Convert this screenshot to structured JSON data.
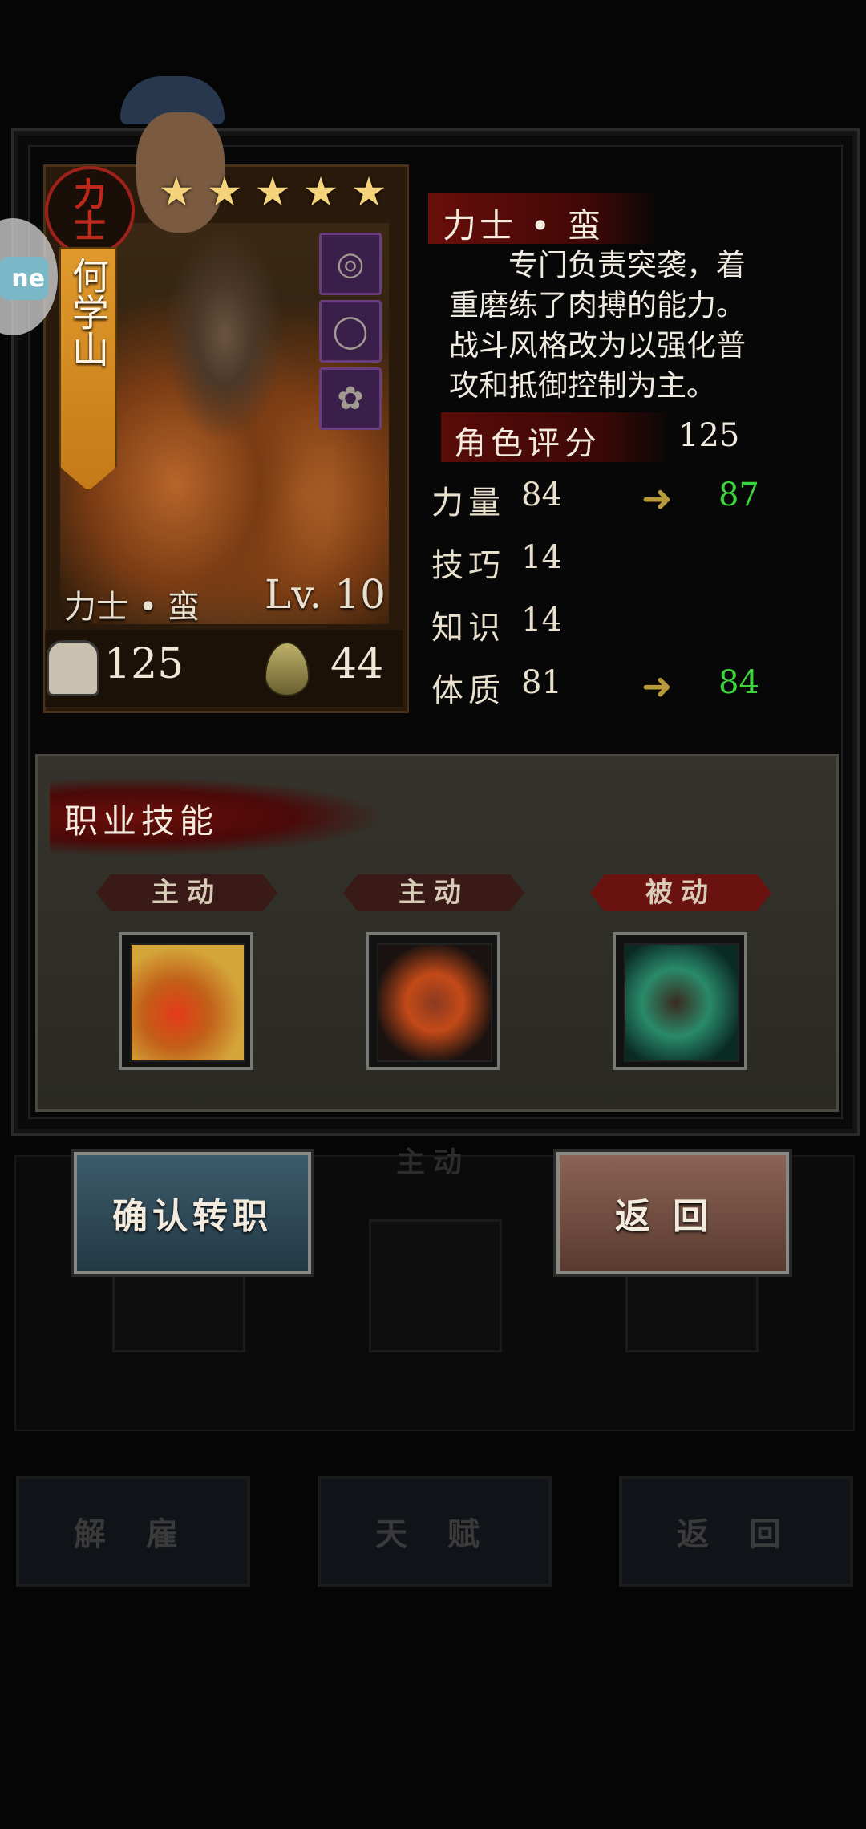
{
  "background": {
    "buttons": [
      "解 雇",
      "天 赋",
      "返 回"
    ],
    "ghost_tag": "主动"
  },
  "side_chip": "ne",
  "card": {
    "class_badge": "力士",
    "name": "何学山",
    "stars": 5,
    "class_name": "力士 • 蛮",
    "level": "Lv. 10",
    "power": "125",
    "stamina": "44",
    "equipment": [
      "ring-icon",
      "ring-icon",
      "charm-icon"
    ]
  },
  "info": {
    "title": "力士 • 蛮",
    "description": "　　专门负责突袭，着\n重磨练了肉搏的能力。\n战斗风格改为以强化普\n攻和抵御控制为主。",
    "score_label": "角色评分",
    "score_value": "125",
    "stats": [
      {
        "label": "力量",
        "value": "84",
        "new": "87"
      },
      {
        "label": "技巧",
        "value": "14",
        "new": ""
      },
      {
        "label": "知识",
        "value": "14",
        "new": ""
      },
      {
        "label": "体质",
        "value": "81",
        "new": "84"
      }
    ],
    "new_value_color": "#3bd63b"
  },
  "skills": {
    "title": "职业技能",
    "items": [
      {
        "tag": "主动"
      },
      {
        "tag": "主动"
      },
      {
        "tag": "被动"
      }
    ]
  },
  "actions": {
    "confirm": "确认转职",
    "back": "返回"
  }
}
